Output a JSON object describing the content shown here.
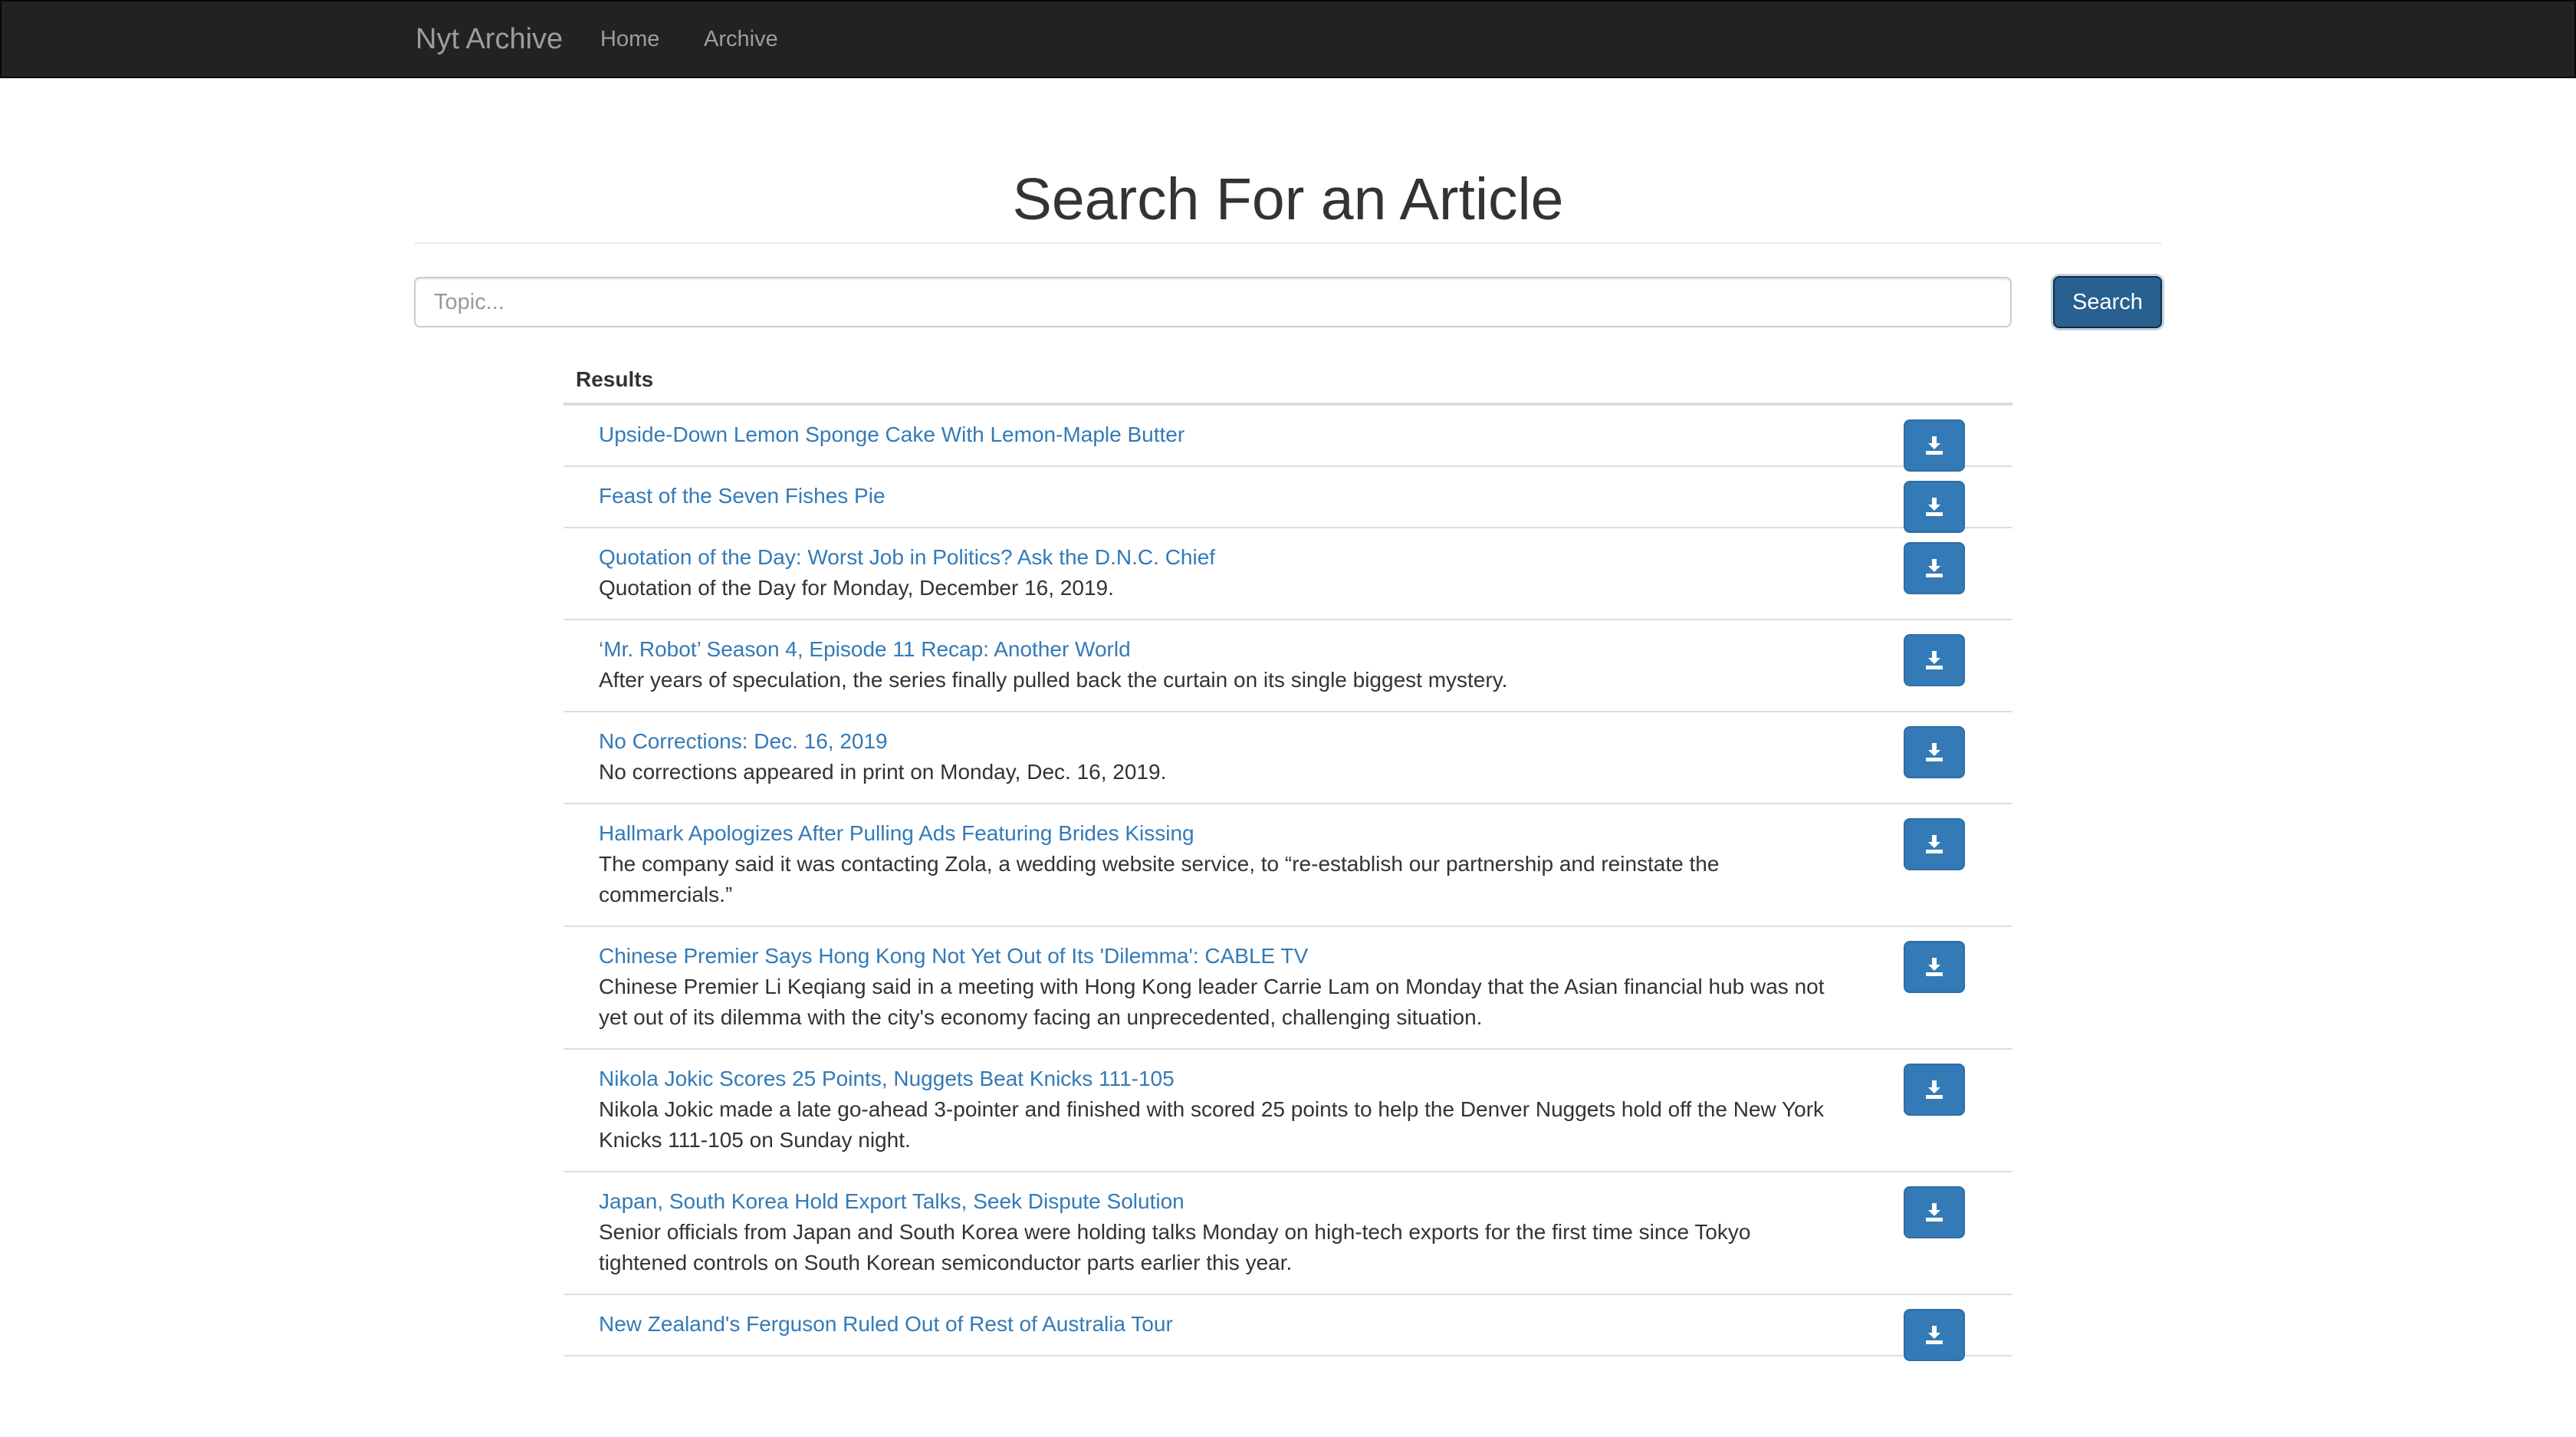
{
  "navbar": {
    "brand": "Nyt Archive",
    "links": [
      {
        "label": "Home"
      },
      {
        "label": "Archive"
      }
    ]
  },
  "header": {
    "title": "Search For an Article"
  },
  "search": {
    "placeholder": "Topic...",
    "value": "",
    "button_label": "Search"
  },
  "results": {
    "heading": "Results",
    "download_icon": "download-icon",
    "items": [
      {
        "title": "Upside-Down Lemon Sponge Cake With Lemon-Maple Butter",
        "description": ""
      },
      {
        "title": "Feast of the Seven Fishes Pie",
        "description": ""
      },
      {
        "title": "Quotation of the Day: Worst Job in Politics? Ask the D.N.C. Chief",
        "description": "Quotation of the Day for Monday, December 16, 2019."
      },
      {
        "title": "‘Mr. Robot’ Season 4, Episode 11 Recap: Another World",
        "description": "After years of speculation, the series finally pulled back the curtain on its single biggest mystery."
      },
      {
        "title": "No Corrections: Dec. 16, 2019",
        "description": "No corrections appeared in print on Monday, Dec. 16, 2019."
      },
      {
        "title": "Hallmark Apologizes After Pulling Ads Featuring Brides Kissing",
        "description": "The company said it was contacting Zola, a wedding website service, to “re-establish our partnership and reinstate the commercials.”"
      },
      {
        "title": "Chinese Premier Says Hong Kong Not Yet Out of Its 'Dilemma': CABLE TV",
        "description": "Chinese Premier Li Keqiang said in a meeting with Hong Kong leader Carrie Lam on Monday that the Asian financial hub was not yet out of its dilemma with the city's economy facing an unprecedented, challenging situation."
      },
      {
        "title": "Nikola Jokic Scores 25 Points, Nuggets Beat Knicks 111-105",
        "description": "Nikola Jokic made a late go-ahead 3-pointer and finished with scored 25 points to help the Denver Nuggets hold off the New York Knicks 111-105 on Sunday night."
      },
      {
        "title": "Japan, South Korea Hold Export Talks, Seek Dispute Solution",
        "description": "Senior officials from Japan and South Korea were holding talks Monday on high-tech exports for the first time since Tokyo tightened controls on South Korean semiconductor parts earlier this year."
      },
      {
        "title": "New Zealand's Ferguson Ruled Out of Rest of Australia Tour",
        "description": ""
      }
    ]
  },
  "colors": {
    "navbar_bg": "#222222",
    "link": "#337ab7",
    "primary_button": "#286090"
  }
}
